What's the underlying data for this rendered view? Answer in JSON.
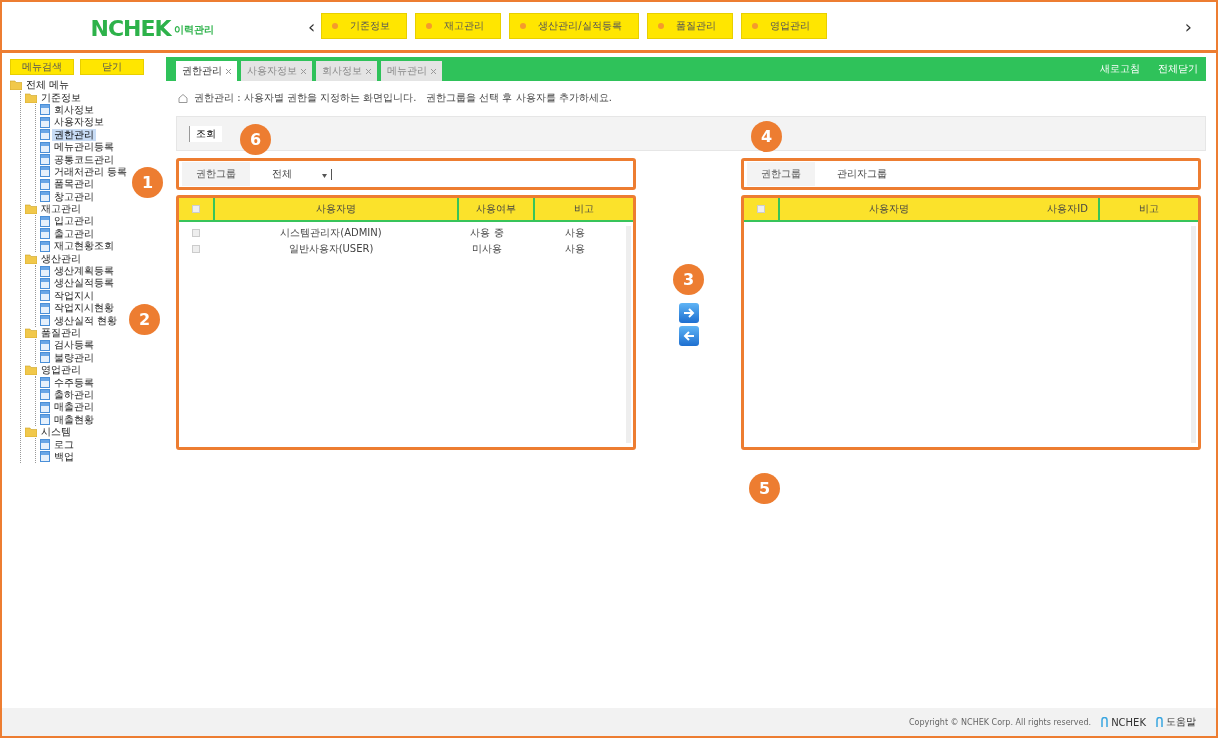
{
  "header": {
    "logo": {
      "main": "NCHEK",
      "sub": "이력관리"
    },
    "prev": "‹",
    "next": "›",
    "menu": [
      {
        "label": "기준정보"
      },
      {
        "label": "재고관리"
      },
      {
        "label": "생산관리/실적등록"
      },
      {
        "label": "품질관리"
      },
      {
        "label": "영업관리"
      }
    ]
  },
  "sidebar": {
    "buttons": [
      "메뉴검색",
      "닫기"
    ],
    "tree": [
      {
        "label": "전체 메뉴",
        "kind": "root",
        "expanded": true,
        "selected": false,
        "children": [
          {
            "label": "기준정보",
            "kind": "folder",
            "expanded": true,
            "selected": false,
            "children": [
              {
                "label": "회사정보",
                "kind": "page",
                "selected": false
              },
              {
                "label": "사용자정보",
                "kind": "page",
                "selected": false
              },
              {
                "label": "권한관리",
                "kind": "page",
                "selected": true
              },
              {
                "label": "메뉴관리등록",
                "kind": "page",
                "selected": false
              },
              {
                "label": "공통코드관리",
                "kind": "page",
                "selected": false
              },
              {
                "label": "거래처관리 등록",
                "kind": "page",
                "selected": false
              },
              {
                "label": "품목관리",
                "kind": "page",
                "selected": false
              },
              {
                "label": "창고관리",
                "kind": "page",
                "selected": false
              }
            ]
          },
          {
            "label": "재고관리",
            "kind": "folder",
            "expanded": true,
            "selected": false,
            "children": [
              {
                "label": "입고관리",
                "kind": "page",
                "selected": false
              },
              {
                "label": "출고관리",
                "kind": "page",
                "selected": false
              },
              {
                "label": "재고현황조회",
                "kind": "page",
                "selected": false
              }
            ]
          },
          {
            "label": "생산관리",
            "kind": "folder",
            "expanded": true,
            "selected": false,
            "children": [
              {
                "label": "생산계획등록",
                "kind": "page",
                "selected": false
              },
              {
                "label": "생산실적등록",
                "kind": "page",
                "selected": false
              },
              {
                "label": "작업지시",
                "kind": "page",
                "selected": false
              },
              {
                "label": "작업지시현황",
                "kind": "page",
                "selected": false
              },
              {
                "label": "생산실적 현황",
                "kind": "page",
                "selected": false
              }
            ]
          },
          {
            "label": "품질관리",
            "kind": "folder",
            "expanded": true,
            "selected": false,
            "children": [
              {
                "label": "검사등록",
                "kind": "page",
                "selected": false
              },
              {
                "label": "불량관리",
                "kind": "page",
                "selected": false
              }
            ]
          },
          {
            "label": "영업관리",
            "kind": "folder",
            "expanded": true,
            "selected": false,
            "children": [
              {
                "label": "수주등록",
                "kind": "page",
                "selected": false
              },
              {
                "label": "출하관리",
                "kind": "page",
                "selected": false
              },
              {
                "label": "매출관리",
                "kind": "page",
                "selected": false
              },
              {
                "label": "매출현황",
                "kind": "page",
                "selected": false
              }
            ]
          },
          {
            "label": "시스템",
            "kind": "folder",
            "expanded": true,
            "selected": false,
            "children": [
              {
                "label": "로그",
                "kind": "page",
                "selected": false
              },
              {
                "label": "백업",
                "kind": "page",
                "selected": false
              }
            ]
          }
        ]
      }
    ]
  },
  "tabs": [
    {
      "label": "권한관리",
      "selected": true
    },
    {
      "label": "사용자정보",
      "selected": false
    },
    {
      "label": "회사정보",
      "selected": false
    },
    {
      "label": "메뉴관리",
      "selected": false
    }
  ],
  "tab_actions": [
    "새로고침",
    "전체닫기"
  ],
  "breadcrumb": "권한관리 : 사용자별 권한을 지정하는 화면입니다.   권한그룹을 선택 후 사용자를 추가하세요.",
  "toolbar": {
    "button": "조회"
  },
  "left_panel": {
    "filter_label": "권한그룹",
    "filter_value": "전체",
    "header_checked": false,
    "columns": [
      "사용자명",
      "사용여부",
      "비고"
    ],
    "rows": [
      {
        "cells": [
          "시스템관리자(ADMIN)",
          "사용 중",
          "사용"
        ],
        "checked": false
      },
      {
        "cells": [
          "일반사용자(USER)",
          "미사용",
          "사용"
        ],
        "checked": false
      }
    ]
  },
  "right_panel": {
    "filter_label": "권한그룹",
    "filter_value": "관리자그룹",
    "header_checked": false,
    "columns": [
      "사용자명",
      "사용자ID",
      "비고"
    ]
  },
  "callouts": [
    "1",
    "2",
    "3",
    "4",
    "5",
    "6"
  ],
  "footer": {
    "copyright": "Copyright © NCHEK Corp. All rights reserved.",
    "links": [
      "NCHEK",
      "도움말"
    ]
  }
}
